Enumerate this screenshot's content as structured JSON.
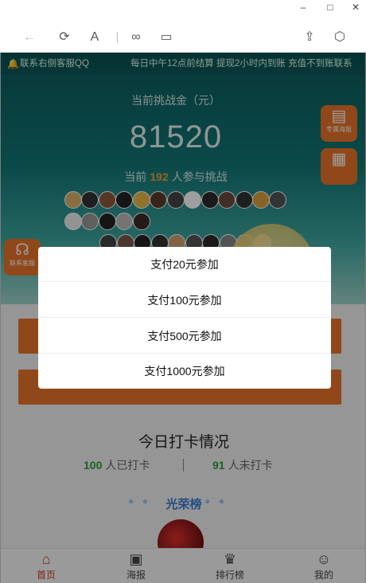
{
  "window": {
    "minimize_glyph": "–",
    "maximize_glyph": "□",
    "close_glyph": "✕"
  },
  "toolbar": {
    "back_glyph": "←",
    "refresh_glyph": "⟳",
    "font_glyph": "A",
    "link_glyph": "∞",
    "reader_glyph": "▭",
    "share_glyph": "⇪",
    "cube_glyph": "⬡"
  },
  "notice": {
    "contact": "联系右侧客服QQ",
    "marquee": "每日中午12点前结算 提现2小时内到账 充值不到账联系"
  },
  "pool": {
    "label": "当前挑战金（元）",
    "amount": "81520",
    "participants_prefix": "当前",
    "participants_count": "192",
    "participants_suffix": "人参与挑战"
  },
  "floating": {
    "right_top_label": "专属海报",
    "right_mid_label": "",
    "left_label": "联系客服"
  },
  "checkin": {
    "title": "今日打卡情况",
    "checked_count": "100",
    "checked_label": "人已打卡",
    "unchecked_count": "91",
    "unchecked_label": "人未打卡"
  },
  "honor": {
    "title": "光荣榜"
  },
  "tabs": [
    {
      "label": "首页",
      "icon": "home-icon",
      "glyph": "⌂"
    },
    {
      "label": "海报",
      "icon": "poster-icon",
      "glyph": "▣"
    },
    {
      "label": "排行榜",
      "icon": "trophy-icon",
      "glyph": "♛"
    },
    {
      "label": "我的",
      "icon": "user-icon",
      "glyph": "☺"
    }
  ],
  "sheet": {
    "options": [
      "支付20元参加",
      "支付100元参加",
      "支付500元参加",
      "支付1000元参加"
    ]
  },
  "colors": {
    "accent_orange": "#e8752a",
    "active_tab": "#d03a2a",
    "checkin_green": "#2f9a3e",
    "honor_blue": "#3a7bd5"
  }
}
